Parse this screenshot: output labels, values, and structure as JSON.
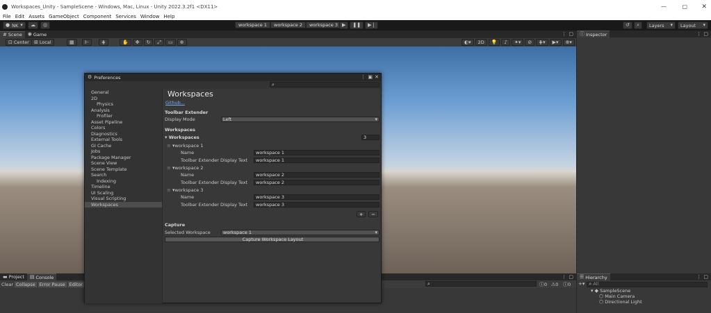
{
  "window": {
    "title": "Workspaces_Unity - SampleScene - Windows, Mac, Linux - Unity 2022.3.2f1 <DX11>"
  },
  "menu": [
    "File",
    "Edit",
    "Assets",
    "GameObject",
    "Component",
    "Services",
    "Window",
    "Help"
  ],
  "toolbar": {
    "account": "NK",
    "workspaces": [
      "workspace 1",
      "workspace 2",
      "workspace 3"
    ],
    "layers": "Layers",
    "layout": "Layout"
  },
  "scene": {
    "tabs": [
      "Scene",
      "Game"
    ],
    "pivot": "Center",
    "space": "Local",
    "mode_2d": "2D"
  },
  "inspector": {
    "tab": "Inspector"
  },
  "project": {
    "tabs": [
      "Project",
      "Console"
    ],
    "buttons": [
      "Clear",
      "Collapse",
      "Error Pause",
      "Editor"
    ],
    "counts": [
      "0",
      "0",
      "0"
    ]
  },
  "hierarchy": {
    "tab": "Hierarchy",
    "search": "All",
    "scene": "SampleScene",
    "items": [
      "Main Camera",
      "Directional Light"
    ]
  },
  "preferences": {
    "title": "Preferences",
    "nav": [
      {
        "label": "General",
        "sub": false
      },
      {
        "label": "2D",
        "sub": false
      },
      {
        "label": "Physics",
        "sub": true
      },
      {
        "label": "Analysis",
        "sub": false
      },
      {
        "label": "Profiler",
        "sub": true
      },
      {
        "label": "Asset Pipeline",
        "sub": false
      },
      {
        "label": "Colors",
        "sub": false
      },
      {
        "label": "Diagnostics",
        "sub": false
      },
      {
        "label": "External Tools",
        "sub": false
      },
      {
        "label": "GI Cache",
        "sub": false
      },
      {
        "label": "Jobs",
        "sub": false
      },
      {
        "label": "Package Manager",
        "sub": false
      },
      {
        "label": "Scene View",
        "sub": false
      },
      {
        "label": "Scene Template",
        "sub": false
      },
      {
        "label": "Search",
        "sub": false
      },
      {
        "label": "Indexing",
        "sub": true
      },
      {
        "label": "Timeline",
        "sub": false
      },
      {
        "label": "UI Scaling",
        "sub": false
      },
      {
        "label": "Visual Scripting",
        "sub": false
      },
      {
        "label": "Workspaces",
        "sub": false,
        "selected": true
      }
    ],
    "heading": "Workspaces",
    "github": "Github...",
    "toolbar_extender": "Toolbar Extender",
    "display_mode_label": "Display Mode",
    "display_mode": "Left",
    "workspaces_section": "Workspaces",
    "workspaces_list": "Workspaces",
    "count": "3",
    "name_label": "Name",
    "display_text_label": "Toolbar Extender Display Text",
    "items": [
      {
        "header": "workspace 1",
        "name": "workspace 1",
        "display": "workspace 1"
      },
      {
        "header": "workspace 2",
        "name": "workspace 2",
        "display": "workspace 2"
      },
      {
        "header": "workspace 3",
        "name": "workspace 3",
        "display": "workspace 3"
      }
    ],
    "add": "+",
    "remove": "−",
    "capture": "Capture",
    "selected_label": "Selected Workspace",
    "selected": "workspace 1",
    "capture_button": "Capture Workspace Layout"
  }
}
